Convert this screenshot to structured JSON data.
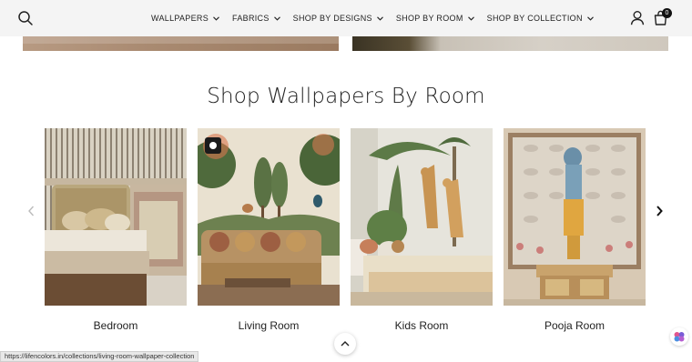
{
  "header": {
    "nav": [
      {
        "label": "WALLPAPERS"
      },
      {
        "label": "FABRICS"
      },
      {
        "label": "SHOP BY DESIGNS"
      },
      {
        "label": "SHOP BY ROOM"
      },
      {
        "label": "SHOP BY COLLECTION"
      }
    ],
    "cart_count": "0",
    "icons": {
      "search": "search-icon",
      "account": "user-icon",
      "cart": "shopping-bag-icon"
    }
  },
  "section": {
    "title": "Shop Wallpapers By Room"
  },
  "rooms": [
    {
      "label": "Bedroom"
    },
    {
      "label": "Living Room"
    },
    {
      "label": "Kids Room"
    },
    {
      "label": "Pooja Room"
    }
  ],
  "status_bar": {
    "url": "https://lifencolors.in/collections/living-room-wallpaper-collection"
  },
  "colors": {
    "header_bg": "#f4f4f4",
    "text": "#222222",
    "badge": "#111111"
  }
}
